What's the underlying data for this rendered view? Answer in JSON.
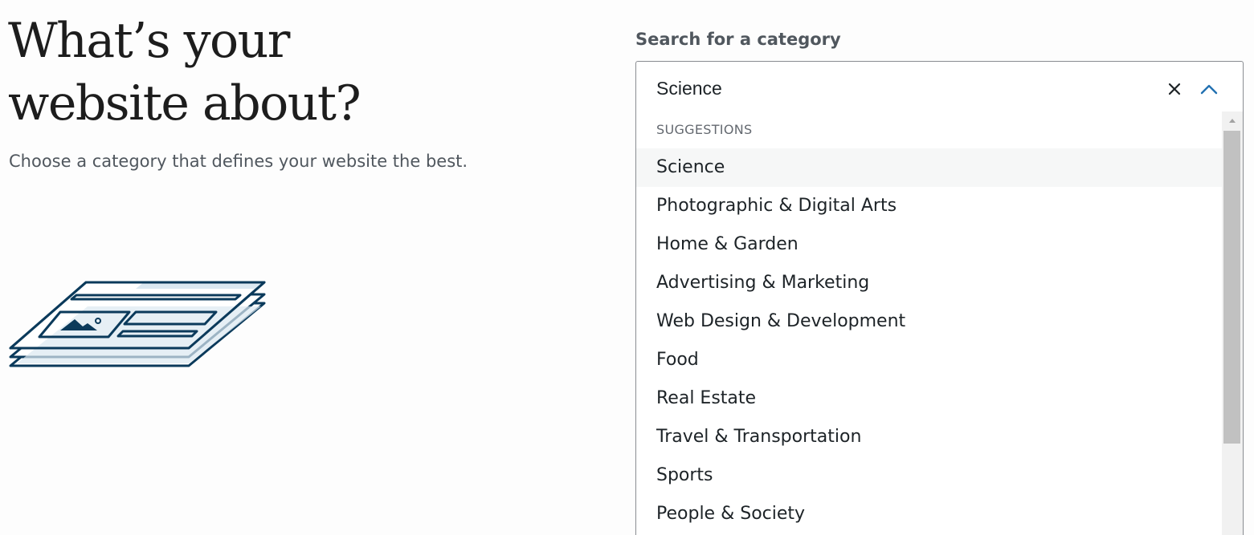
{
  "intro": {
    "title_line1": "What’s your",
    "title_line2": "website about?",
    "subtitle": "Choose a category that defines your website the best."
  },
  "category_search": {
    "label": "Search for a category",
    "value": "Science",
    "clear_icon": "close-icon",
    "toggle_icon": "chevron-up-icon",
    "suggestions_heading": "SUGGESTIONS",
    "highlighted_index": 0,
    "options": [
      "Science",
      "Photographic & Digital Arts",
      "Home & Garden",
      "Advertising & Marketing",
      "Web Design & Development",
      "Food",
      "Real Estate",
      "Travel & Transportation",
      "Sports",
      "People & Society"
    ]
  },
  "colors": {
    "illustration_stroke": "#0b3a5b",
    "illustration_fill": "#dbe8f1",
    "accent": "#2271b1",
    "highlight_bg": "#f6f7f7"
  }
}
